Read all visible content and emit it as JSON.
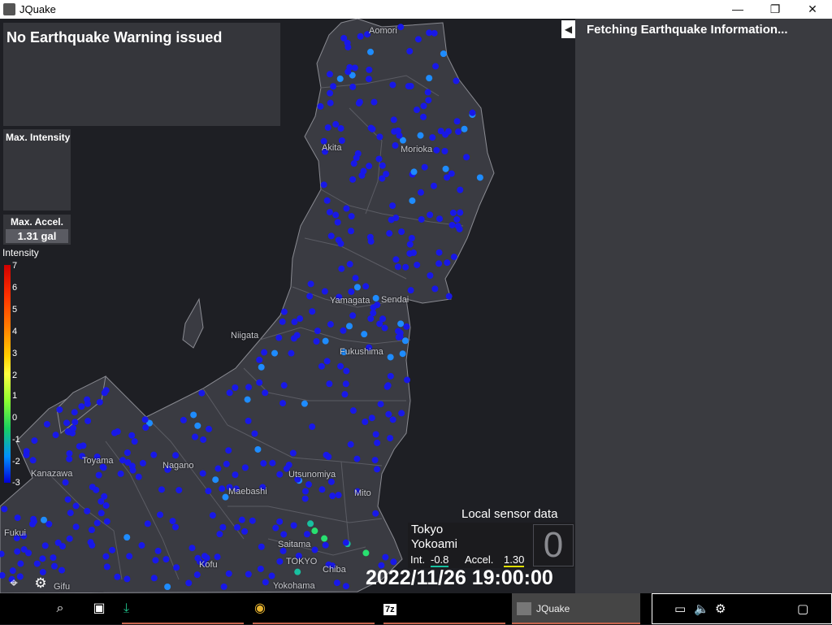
{
  "window": {
    "title": "JQuake",
    "minimize": "—",
    "maximize": "❐",
    "close": "✕"
  },
  "warning": {
    "text": "No Earthquake Warning issued"
  },
  "max_intensity": {
    "label": "Max. Intensity"
  },
  "max_accel": {
    "label": "Max. Accel.",
    "value": "1.31 gal"
  },
  "intensity_scale": {
    "title": "Intensity",
    "ticks": [
      "7",
      "6",
      "5",
      "4",
      "3",
      "2",
      "1",
      "0",
      "-1",
      "-2",
      "-3"
    ]
  },
  "cities": [
    {
      "name": "Aomori"
    },
    {
      "name": "Akita"
    },
    {
      "name": "Morioka"
    },
    {
      "name": "Yamagata"
    },
    {
      "name": "Sendai"
    },
    {
      "name": "Niigata"
    },
    {
      "name": "Fukushima"
    },
    {
      "name": "Toyama"
    },
    {
      "name": "Nagano"
    },
    {
      "name": "Utsunomiya"
    },
    {
      "name": "Kanazawa"
    },
    {
      "name": "Maebashi"
    },
    {
      "name": "Mito"
    },
    {
      "name": "Fukui"
    },
    {
      "name": "Saitama"
    },
    {
      "name": "Kofu"
    },
    {
      "name": "TOKYO"
    },
    {
      "name": "Chiba"
    },
    {
      "name": "Yokohama"
    },
    {
      "name": "Gifu"
    }
  ],
  "local_sensor": {
    "title": "Local sensor data",
    "location_line1": "Tokyo",
    "location_line2": "Yokoami",
    "int_label": "Int.",
    "int_value": "-0.8",
    "accel_label": "Accel.",
    "accel_value": "1.30",
    "shindo": "0"
  },
  "clock": "2022/11/26 19:00:00",
  "controls": {
    "locate": "⌖",
    "settings": "⚙"
  },
  "right_panel": {
    "collapse": "◀",
    "status": "Fetching Earthquake Information..."
  },
  "taskbar": {
    "search_icon": "⌕",
    "taskview_icon": "▣",
    "download_icon": "⤓",
    "chrome_icon": "◉",
    "sevenzip_icon": "7z",
    "jquake_label": "JQuake",
    "tray": {
      "network": "▭",
      "volume": "🔈",
      "gear": "⚙",
      "notifications": "▢"
    }
  },
  "colors": {
    "station_default": "#1818e8",
    "station_low": "#1e8cff",
    "station_mid": "#18c0a0",
    "station_green": "#28e070",
    "accent": "#c8644e"
  }
}
